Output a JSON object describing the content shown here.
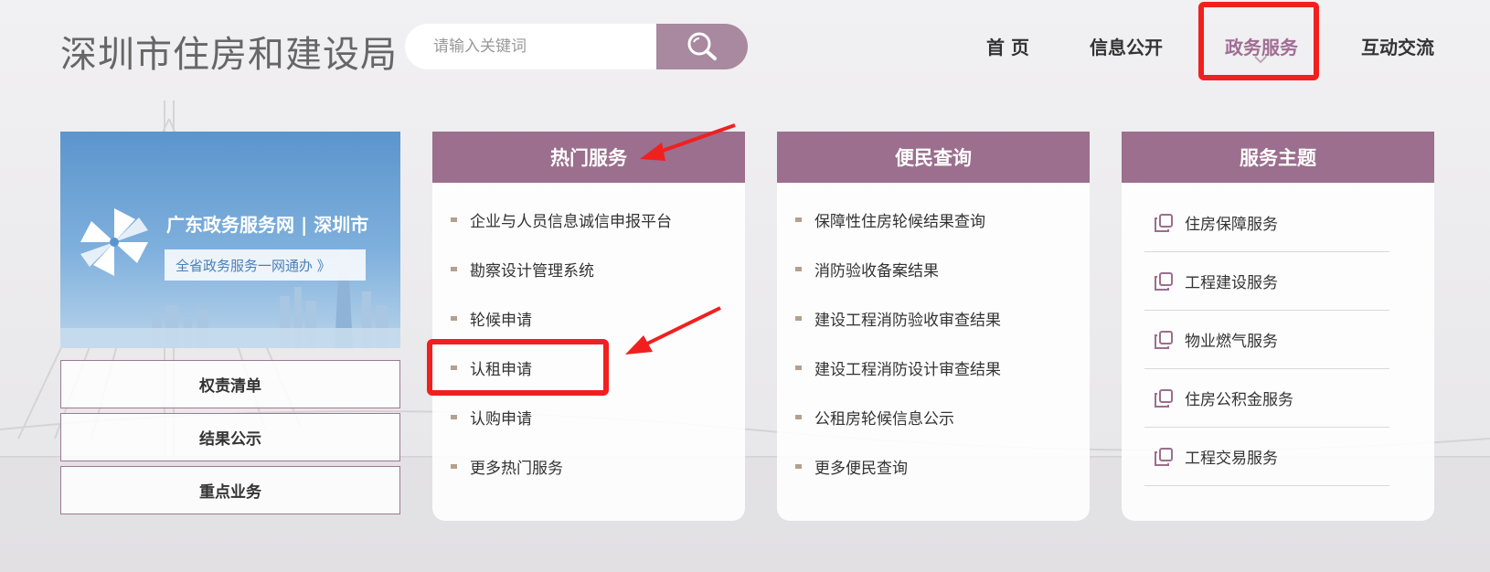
{
  "header": {
    "site_title": "深圳市住房和建设局",
    "search_placeholder": "请输入关键词"
  },
  "nav": {
    "items": [
      "首 页",
      "信息公开",
      "政务服务",
      "互动交流"
    ],
    "active_index": 2
  },
  "banner": {
    "title": "广东政务服务网 | 深圳市",
    "subtitle": "全省政务服务一网通办 》"
  },
  "side_buttons": [
    "权责清单",
    "结果公示",
    "重点业务"
  ],
  "hot_services": {
    "title": "热门服务",
    "items": [
      "企业与人员信息诚信申报平台",
      "勘察设计管理系统",
      "轮候申请",
      "认租申请",
      "认购申请",
      "更多热门服务"
    ]
  },
  "public_query": {
    "title": "便民查询",
    "items": [
      "保障性住房轮候结果查询",
      "消防验收备案结果",
      "建设工程消防验收审查结果",
      "建设工程消防设计审查结果",
      "公租房轮候信息公示",
      "更多便民查询"
    ]
  },
  "service_topics": {
    "title": "服务主题",
    "items": [
      "住房保障服务",
      "工程建设服务",
      "物业燃气服务",
      "住房公积金服务",
      "工程交易服务"
    ]
  },
  "colors": {
    "accent": "#9b6f8d",
    "active_nav": "#a06d94",
    "highlight": "#f0201f",
    "search_button": "#a8899f"
  }
}
